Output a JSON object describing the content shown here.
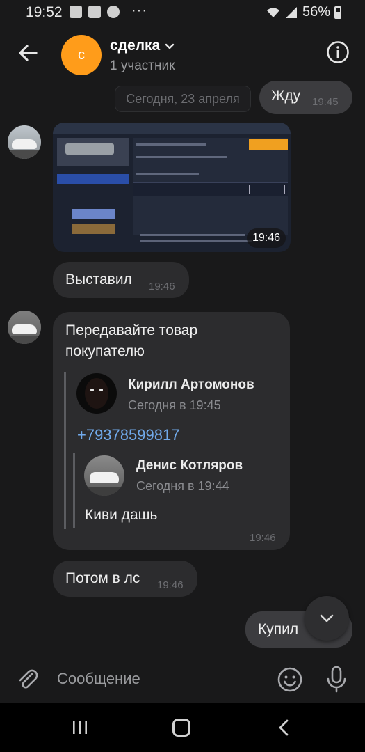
{
  "status_bar": {
    "time": "19:52",
    "dots": "···",
    "battery_percent": "56%"
  },
  "header": {
    "title": "сделка",
    "subtitle": "1 участник",
    "avatar_letter": "с"
  },
  "date_separator": "Сегодня, 23 апреля",
  "messages": {
    "m1": {
      "text": "Жду",
      "time": "19:45"
    },
    "photo": {
      "time": "19:46"
    },
    "m2": {
      "text": "Выставил",
      "time": "19:46"
    },
    "m3": {
      "text": "Передавайте товар покупателю",
      "time": "19:46",
      "forward": {
        "name": "Кирилл Артомонов",
        "time": "Сегодня в 19:45",
        "phone": "+79378599817",
        "nested": {
          "name": "Денис Котляров",
          "time": "Сегодня в 19:44",
          "text": "Киви дашь"
        }
      }
    },
    "m4": {
      "text": "Потом в лс",
      "time": "19:46"
    },
    "m5": {
      "text": "Купил"
    }
  },
  "composer": {
    "placeholder": "Сообщение"
  },
  "icons": {
    "back": "arrow-left-icon",
    "info": "info-icon",
    "attach": "paperclip-icon",
    "emoji": "smiley-icon",
    "mic": "microphone-icon",
    "scroll": "chevron-down-icon"
  },
  "colors": {
    "avatar_orange": "#ff9c1a",
    "link_blue": "#71aaeb",
    "bg": "#19191a",
    "bubble_in": "#2c2c2e",
    "bubble_out": "#3c3c3f"
  }
}
